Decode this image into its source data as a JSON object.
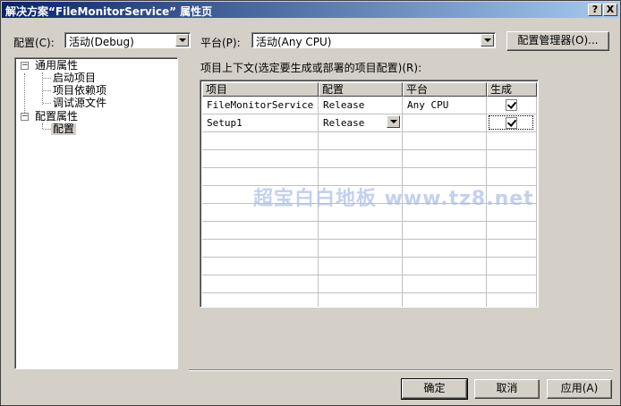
{
  "window": {
    "title": "解决方案“FileMonitorService” 属性页",
    "help_label": "?",
    "close_label": "X"
  },
  "config": {
    "label": "配置(C):",
    "value": "活动(Debug)"
  },
  "platform": {
    "label": "平台(P):",
    "value": "活动(Any CPU)"
  },
  "config_manager_label": "配置管理器(O)...",
  "tree": {
    "items": [
      {
        "label": "通用属性",
        "expander": "−"
      },
      {
        "label": "启动项目"
      },
      {
        "label": "项目依赖项"
      },
      {
        "label": "调试源文件"
      },
      {
        "label": "配置属性",
        "expander": "−"
      },
      {
        "label": "配置"
      }
    ]
  },
  "context_label": "项目上下文(选定要生成或部署的项目配置)(R):",
  "grid": {
    "headers": [
      "项目",
      "配置",
      "平台",
      "生成"
    ],
    "rows": [
      {
        "project": "FileMonitorService",
        "config": "Release",
        "platform": "Any CPU",
        "build": true
      },
      {
        "project": "Setup1",
        "config": "Release",
        "platform": "",
        "build": true
      }
    ]
  },
  "watermark": "超宝白白地板 www.tz8.net",
  "buttons": {
    "ok": "确定",
    "cancel": "取消",
    "apply": "应用(A)"
  }
}
